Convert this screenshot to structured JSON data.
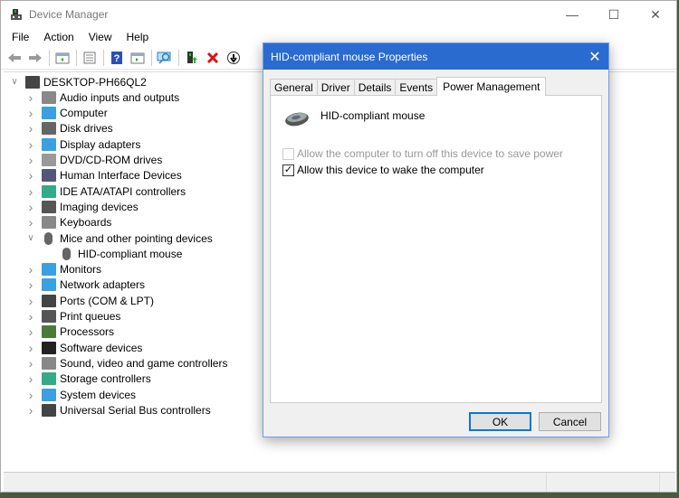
{
  "window": {
    "title": "Device Manager",
    "controls": [
      "minimize",
      "maximize",
      "close"
    ]
  },
  "menu": [
    "File",
    "Action",
    "View",
    "Help"
  ],
  "toolbar": [
    "back-icon",
    "forward-icon",
    "show-hide-console-tree-icon",
    "properties-icon",
    "help-icon",
    "show-hide-action-pane-icon",
    "scan-hardware-icon",
    "update-driver-icon",
    "uninstall-icon",
    "disable-icon"
  ],
  "tree": {
    "root": "DESKTOP-PH66QL2",
    "items": [
      {
        "label": "Audio inputs and outputs",
        "icon": "speaker-icon",
        "expanded": false
      },
      {
        "label": "Computer",
        "icon": "computer-icon",
        "expanded": false
      },
      {
        "label": "Disk drives",
        "icon": "disk-drive-icon",
        "expanded": false
      },
      {
        "label": "Display adapters",
        "icon": "display-adapter-icon",
        "expanded": false
      },
      {
        "label": "DVD/CD-ROM drives",
        "icon": "dvd-icon",
        "expanded": false
      },
      {
        "label": "Human Interface Devices",
        "icon": "hid-icon",
        "expanded": false
      },
      {
        "label": "IDE ATA/ATAPI controllers",
        "icon": "ide-controller-icon",
        "expanded": false
      },
      {
        "label": "Imaging devices",
        "icon": "imaging-icon",
        "expanded": false
      },
      {
        "label": "Keyboards",
        "icon": "keyboard-icon",
        "expanded": false
      },
      {
        "label": "Mice and other pointing devices",
        "icon": "mouse-icon",
        "expanded": true,
        "children": [
          "HID-compliant mouse"
        ]
      },
      {
        "label": "Monitors",
        "icon": "monitor-icon",
        "expanded": false
      },
      {
        "label": "Network adapters",
        "icon": "network-icon",
        "expanded": false
      },
      {
        "label": "Ports (COM & LPT)",
        "icon": "port-icon",
        "expanded": false
      },
      {
        "label": "Print queues",
        "icon": "printer-icon",
        "expanded": false
      },
      {
        "label": "Processors",
        "icon": "processor-icon",
        "expanded": false
      },
      {
        "label": "Software devices",
        "icon": "software-device-icon",
        "expanded": false
      },
      {
        "label": "Sound, video and game controllers",
        "icon": "sound-icon",
        "expanded": false
      },
      {
        "label": "Storage controllers",
        "icon": "storage-icon",
        "expanded": false
      },
      {
        "label": "System devices",
        "icon": "system-devices-icon",
        "expanded": false
      },
      {
        "label": "Universal Serial Bus controllers",
        "icon": "usb-icon",
        "expanded": false
      }
    ]
  },
  "dialog": {
    "title": "HID-compliant mouse Properties",
    "tabs": [
      "General",
      "Driver",
      "Details",
      "Events",
      "Power Management"
    ],
    "active_tab": "Power Management",
    "device_name": "HID-compliant mouse",
    "options": [
      {
        "label": "Allow the computer to turn off this device to save power",
        "checked": false,
        "disabled": true
      },
      {
        "label": "Allow this device to wake the computer",
        "checked": true,
        "disabled": false
      }
    ],
    "ok_label": "OK",
    "cancel_label": "Cancel"
  }
}
